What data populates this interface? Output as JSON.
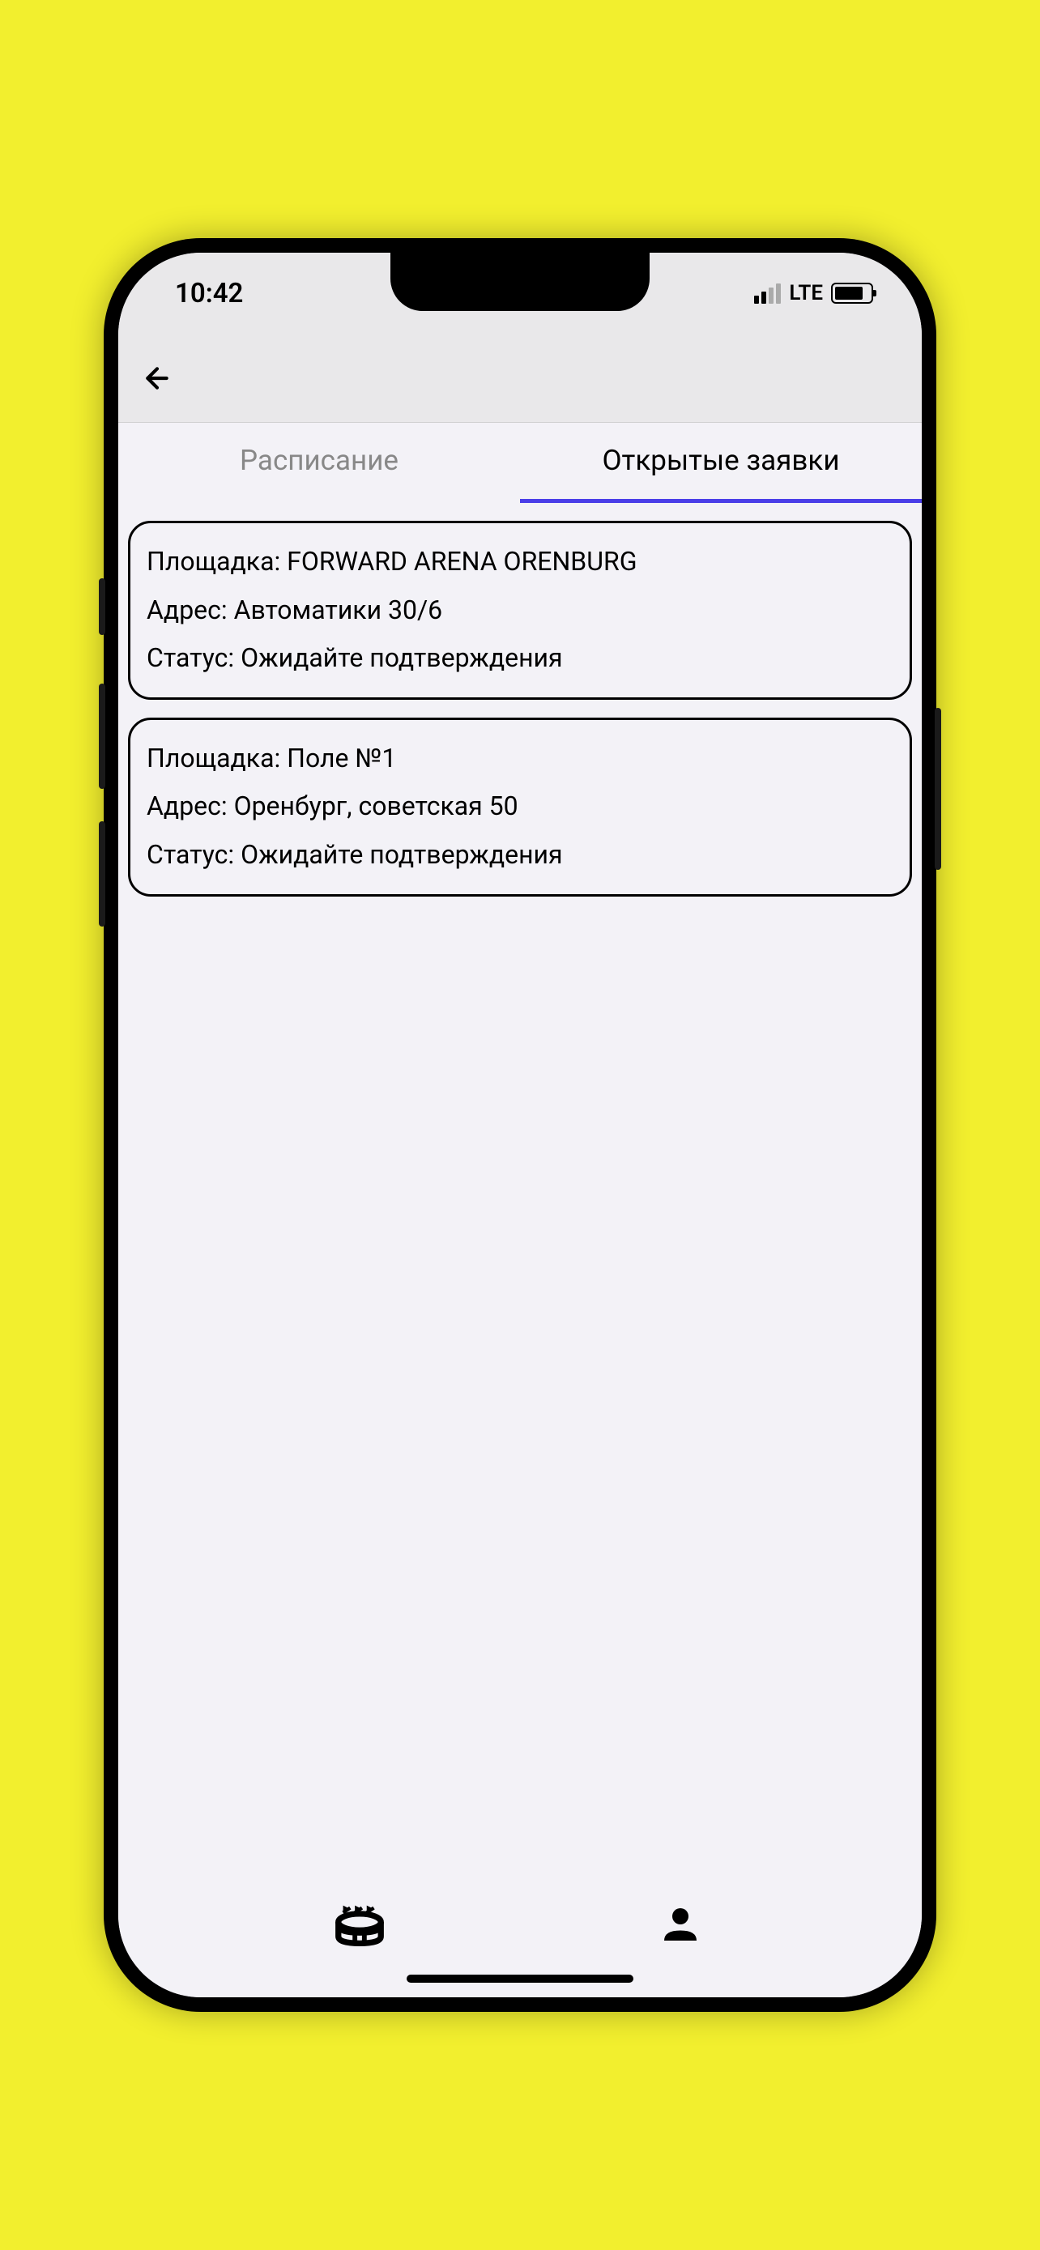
{
  "status_bar": {
    "time": "10:42",
    "network_type": "LTE"
  },
  "tabs": {
    "schedule": "Расписание",
    "open_requests": "Открытые заявки"
  },
  "labels": {
    "venue": "Площадка:",
    "address": "Адрес:",
    "status": "Статус:"
  },
  "cards": [
    {
      "venue": "FORWARD ARENA ORENBURG",
      "address": "Автоматики 30/6",
      "status": "Ожидайте подтверждения"
    },
    {
      "venue": "Поле №1",
      "address": "Оренбург, советская 50",
      "status": "Ожидайте подтверждения"
    }
  ]
}
